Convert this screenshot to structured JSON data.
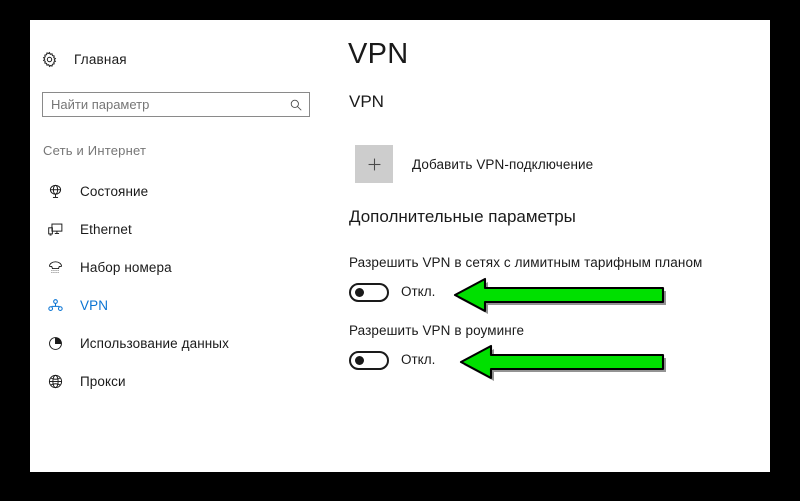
{
  "window": {
    "sidebar": {
      "home": {
        "label": "Главная",
        "icon": "gear-icon"
      },
      "search": {
        "placeholder": "Найти параметр",
        "value": "",
        "icon": "search-icon"
      },
      "group_caption": "Сеть и Интернет",
      "items": [
        {
          "label": "Состояние",
          "icon": "network-status-icon",
          "selected": false
        },
        {
          "label": "Ethernet",
          "icon": "ethernet-icon",
          "selected": false
        },
        {
          "label": "Набор номера",
          "icon": "dial-up-icon",
          "selected": false
        },
        {
          "label": "VPN",
          "icon": "vpn-icon",
          "selected": true
        },
        {
          "label": "Использование данных",
          "icon": "pie-chart-icon",
          "selected": false
        },
        {
          "label": "Прокси",
          "icon": "globe-icon",
          "selected": false
        }
      ]
    },
    "content": {
      "page_title": "VPN",
      "section_vpn": {
        "heading": "VPN",
        "add_connection_label": "Добавить VPN-подключение",
        "add_connection_icon": "plus-icon"
      },
      "section_advanced": {
        "heading": "Дополнительные параметры",
        "settings": [
          {
            "label": "Разрешить VPN в сетях с лимитным тарифным планом",
            "state": "Откл.",
            "on": false
          },
          {
            "label": "Разрешить VPN в роуминге",
            "state": "Откл.",
            "on": false
          }
        ]
      }
    }
  },
  "annotations": {
    "arrows": [
      {
        "name": "arrow-pointing-to-metered-toggle",
        "direction": "left",
        "color": "#00E000"
      },
      {
        "name": "arrow-pointing-to-roaming-toggle",
        "direction": "left",
        "color": "#00E000"
      }
    ]
  },
  "colors": {
    "accent": "#0a74d3",
    "text": "#1a1a1a",
    "muted_text": "#767676",
    "frame": "#000000",
    "plus_button_bg": "#cdcdcd",
    "arrow_green": "#00E000"
  }
}
